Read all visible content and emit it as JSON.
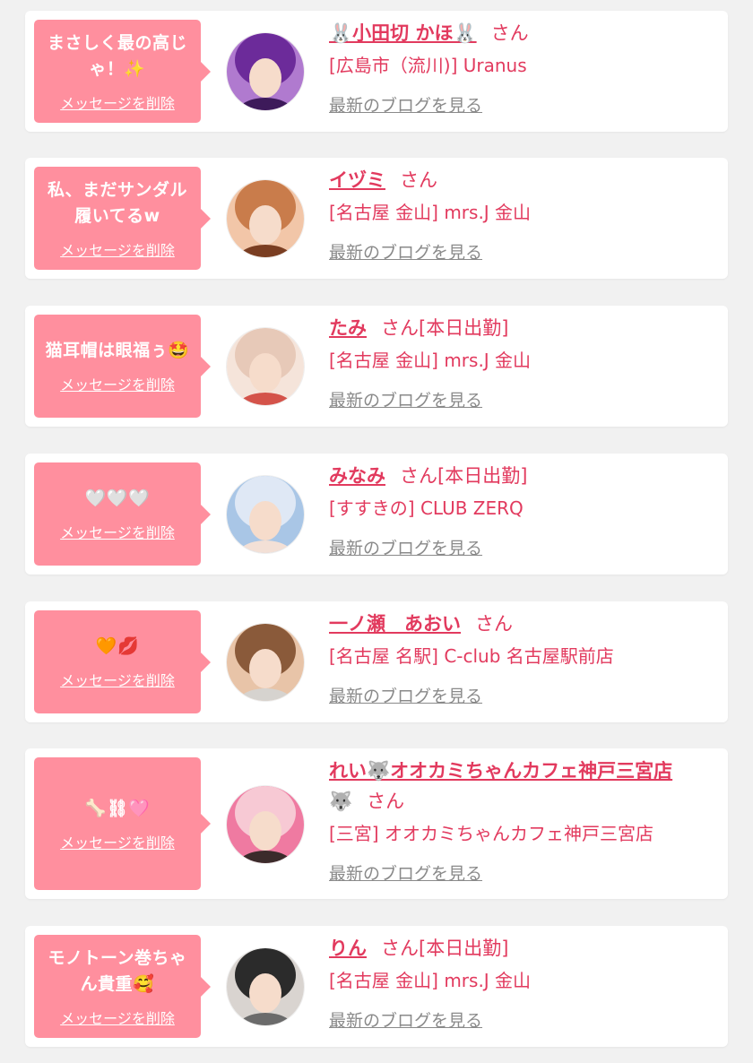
{
  "entries": [
    {
      "message": "まさしく最の高じゃ！✨",
      "delete_label": "メッセージを削除",
      "name": "🐰小田切 かほ🐰",
      "suffix": "さん",
      "shop": "[広島市（流川)] Uranus",
      "blog_label": "最新のブログを見る",
      "avatar_colors": [
        "#6c2b9a",
        "#b07acf",
        "#3d1a5a"
      ]
    },
    {
      "message": "私、まだサンダル履いてるw",
      "delete_label": "メッセージを削除",
      "name": "イヅミ",
      "suffix": "さん",
      "shop": "[名古屋 金山] mrs.J 金山",
      "blog_label": "最新のブログを見る",
      "avatar_colors": [
        "#c97c4b",
        "#f2c6a8",
        "#7a3e22"
      ]
    },
    {
      "message": "猫耳帽は眼福ぅ🤩",
      "delete_label": "メッセージを削除",
      "name": "たみ",
      "suffix": "さん[本日出勤]",
      "shop": "[名古屋 金山] mrs.J 金山",
      "blog_label": "最新のブログを見る",
      "avatar_colors": [
        "#e7c9b8",
        "#f5e4da",
        "#d4534a"
      ]
    },
    {
      "message": "🤍🤍🤍",
      "delete_label": "メッセージを削除",
      "name": "みなみ",
      "suffix": "さん[本日出勤]",
      "shop": "[すすきの] CLUB ZERQ",
      "blog_label": "最新のブログを見る",
      "avatar_colors": [
        "#dfe8f5",
        "#a9c6e6",
        "#f3e0d6"
      ]
    },
    {
      "message": "🧡💋",
      "delete_label": "メッセージを削除",
      "name": "一ノ瀬　あおい",
      "suffix": "さん",
      "shop": "[名古屋 名駅] C-club 名古屋駅前店",
      "blog_label": "最新のブログを見る",
      "avatar_colors": [
        "#8a5a3a",
        "#e8c4a8",
        "#d6d3cf"
      ]
    },
    {
      "message": "🦴⛓🩷",
      "delete_label": "メッセージを削除",
      "name": "れい🐺オオカミちゃんカフェ神戸三宮店",
      "name_extra": "🐺",
      "suffix": "さん",
      "shop": "[三宮] オオカミちゃんカフェ神戸三宮店",
      "blog_label": "最新のブログを見る",
      "avatar_colors": [
        "#f7c9d4",
        "#ef7aa1",
        "#3b2b2b"
      ]
    },
    {
      "message": "モノトーン巻ちゃん貴重🥰",
      "delete_label": "メッセージを削除",
      "name": "りん",
      "suffix": "さん[本日出勤]",
      "shop": "[名古屋 金山] mrs.J 金山",
      "blog_label": "最新のブログを見る",
      "avatar_colors": [
        "#2b2b2b",
        "#d9d4d0",
        "#6b6b6b"
      ]
    }
  ]
}
